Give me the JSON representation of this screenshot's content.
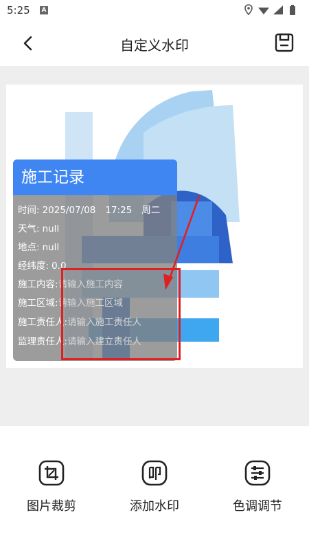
{
  "status_bar": {
    "time": "5:25",
    "app_icon_letter": "A",
    "icons": [
      "location-icon",
      "wifi-icon",
      "signal-icon",
      "battery-icon"
    ]
  },
  "header": {
    "title": "自定义水印",
    "back_icon": "chevron-left-icon",
    "save_icon": "save-icon"
  },
  "watermark": {
    "title": "施工记录",
    "time_label": "时间:",
    "date": "2025/07/08",
    "time": "17:25",
    "weekday": "周二",
    "weather_label": "天气:",
    "weather_value": "null",
    "location_label": "地点:",
    "location_value": "null",
    "coords_label": "经纬度:",
    "coords_value": "0.0",
    "content_label": "施工内容:",
    "content_placeholder": "请输入施工内容",
    "area_label": "施工区域:",
    "area_placeholder": "请输入施工区域",
    "responsible_label": "施工责任人:",
    "responsible_placeholder": "请输入施工责任人",
    "supervisor_label": "监理责任人:",
    "supervisor_placeholder": "请输入建立责任人"
  },
  "toolbar": {
    "items": [
      {
        "label": "图片裁剪",
        "icon": "crop-icon"
      },
      {
        "label": "添加水印",
        "icon": "watermark-stamp-icon"
      },
      {
        "label": "色调调节",
        "icon": "sliders-icon"
      }
    ]
  },
  "colors": {
    "accent": "#3f86f3",
    "annotation": "#e02020",
    "canvas_bg": "#eeeeee"
  }
}
